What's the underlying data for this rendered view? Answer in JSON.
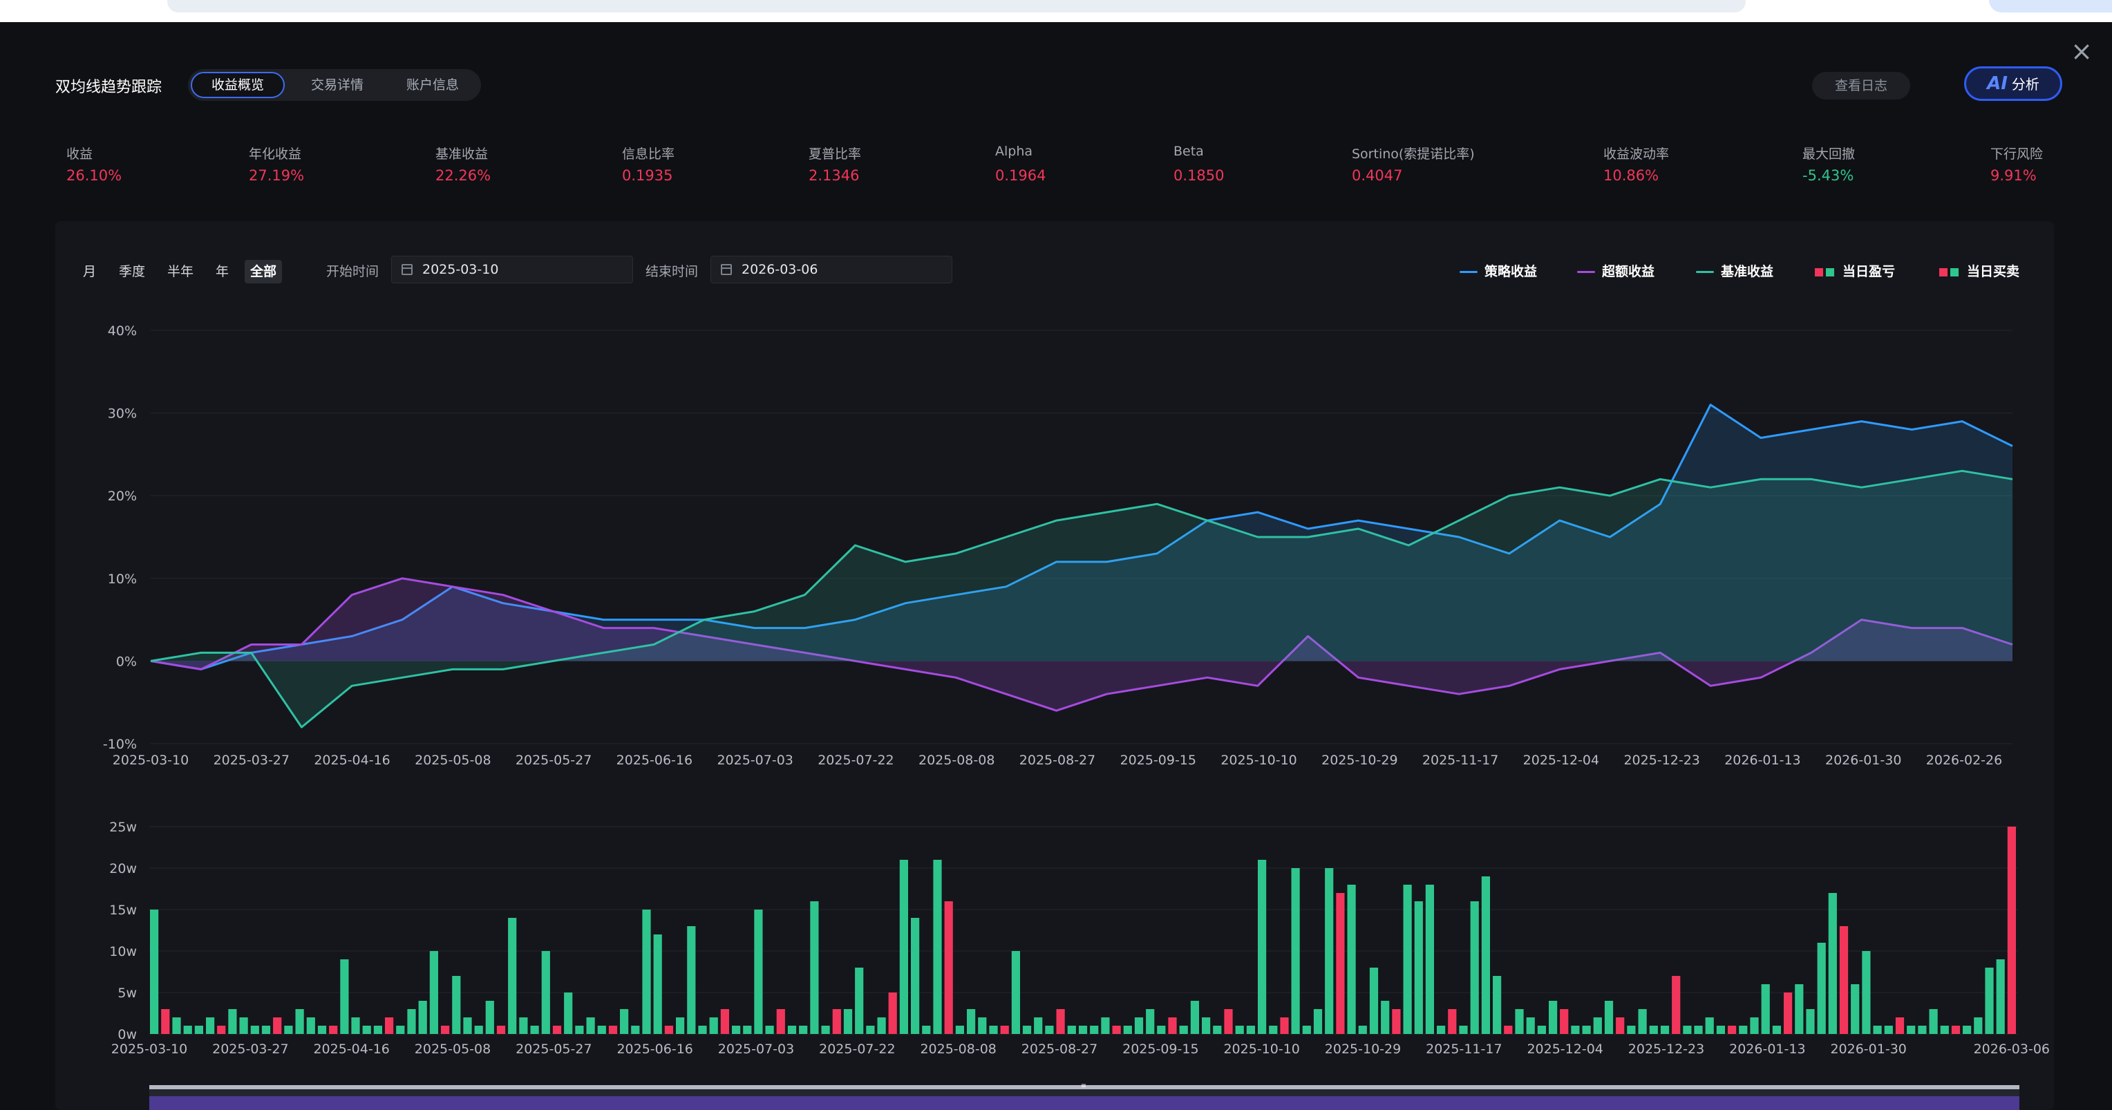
{
  "header": {
    "title": "双均线趋势跟踪",
    "tabs": [
      {
        "label": "收益概览",
        "active": true
      },
      {
        "label": "交易详情",
        "active": false
      },
      {
        "label": "账户信息",
        "active": false
      }
    ],
    "log_button": "查看日志",
    "ai_button": {
      "glyph": "AI",
      "label": "分析"
    },
    "close_icon": "close-icon"
  },
  "metrics": [
    {
      "label": "收益",
      "value": "26.10%",
      "tone": "neg"
    },
    {
      "label": "年化收益",
      "value": "27.19%",
      "tone": "neg"
    },
    {
      "label": "基准收益",
      "value": "22.26%",
      "tone": "neg"
    },
    {
      "label": "信息比率",
      "value": "0.1935",
      "tone": "neg"
    },
    {
      "label": "夏普比率",
      "value": "2.1346",
      "tone": "neg"
    },
    {
      "label": "Alpha",
      "value": "0.1964",
      "tone": "neg"
    },
    {
      "label": "Beta",
      "value": "0.1850",
      "tone": "neg"
    },
    {
      "label": "Sortino(索提诺比率)",
      "value": "0.4047",
      "tone": "neg"
    },
    {
      "label": "收益波动率",
      "value": "10.86%",
      "tone": "neg"
    },
    {
      "label": "最大回撤",
      "value": "-5.43%",
      "tone": "pos"
    },
    {
      "label": "下行风险",
      "value": "9.91%",
      "tone": "neg"
    }
  ],
  "filters": {
    "ranges": [
      {
        "label": "月",
        "active": false
      },
      {
        "label": "季度",
        "active": false
      },
      {
        "label": "半年",
        "active": false
      },
      {
        "label": "年",
        "active": false
      },
      {
        "label": "全部",
        "active": true
      }
    ],
    "start_label": "开始时间",
    "start_value": "2025-03-10",
    "end_label": "结束时间",
    "end_value": "2026-03-06"
  },
  "legend": [
    {
      "label": "策略收益",
      "kind": "line",
      "color": "#2f9bff"
    },
    {
      "label": "超额收益",
      "kind": "line",
      "color": "#a54ce0"
    },
    {
      "label": "基准收益",
      "kind": "line",
      "color": "#2fc1a4"
    },
    {
      "label": "当日盈亏",
      "kind": "squares",
      "colors": [
        "#f2365b",
        "#2fc68d"
      ]
    },
    {
      "label": "当日买卖",
      "kind": "squares",
      "colors": [
        "#f2365b",
        "#2fc68d"
      ]
    }
  ],
  "colors": {
    "strategy": "#2f9bff",
    "excess": "#a54ce0",
    "benchmark": "#2fc1a4",
    "up": "#f2365b",
    "down": "#2fc68d",
    "accent": "#2f5cf5"
  },
  "chart_data": [
    {
      "type": "line",
      "x_ticks": [
        "2025-03-10",
        "2025-03-27",
        "2025-04-16",
        "2025-05-08",
        "2025-05-27",
        "2025-06-16",
        "2025-07-03",
        "2025-07-22",
        "2025-08-08",
        "2025-08-27",
        "2025-09-15",
        "2025-10-10",
        "2025-10-29",
        "2025-11-17",
        "2025-12-04",
        "2025-12-23",
        "2026-01-13",
        "2026-01-30",
        "2026-02-26"
      ],
      "y_ticks": [
        "40%",
        "30%",
        "20%",
        "10%",
        "0%",
        "-10%"
      ],
      "ylim": [
        -10,
        40
      ],
      "area": true,
      "series": [
        {
          "name": "策略收益",
          "values": [
            0,
            -1,
            1,
            2,
            3,
            5,
            9,
            7,
            6,
            5,
            5,
            5,
            4,
            4,
            5,
            7,
            8,
            9,
            12,
            12,
            13,
            17,
            18,
            16,
            17,
            16,
            15,
            13,
            17,
            15,
            19,
            31,
            27,
            28,
            29,
            28,
            29,
            26
          ]
        },
        {
          "name": "超额收益",
          "values": [
            0,
            -1,
            2,
            2,
            8,
            10,
            9,
            8,
            6,
            4,
            4,
            3,
            2,
            1,
            0,
            -1,
            -2,
            -4,
            -6,
            -4,
            -3,
            -2,
            -3,
            3,
            -2,
            -3,
            -4,
            -3,
            -1,
            0,
            1,
            -3,
            -2,
            1,
            5,
            4,
            4,
            2
          ]
        },
        {
          "name": "基准收益",
          "values": [
            0,
            1,
            1,
            -8,
            -3,
            -2,
            -1,
            -1,
            0,
            1,
            2,
            5,
            6,
            8,
            14,
            12,
            13,
            15,
            17,
            18,
            19,
            17,
            15,
            15,
            16,
            14,
            17,
            20,
            21,
            20,
            22,
            21,
            22,
            22,
            21,
            22,
            23,
            22
          ]
        }
      ]
    },
    {
      "type": "bar",
      "x_ticks": [
        "2025-03-10",
        "2025-03-27",
        "2025-04-16",
        "2025-05-08",
        "2025-05-27",
        "2025-06-16",
        "2025-07-03",
        "2025-07-22",
        "2025-08-08",
        "2025-08-27",
        "2025-09-15",
        "2025-10-10",
        "2025-10-29",
        "2025-11-17",
        "2025-12-04",
        "2025-12-23",
        "2026-01-13",
        "2026-01-30",
        "2026-03-06"
      ],
      "y_ticks": [
        "25w",
        "20w",
        "15w",
        "10w",
        "5w",
        "0w"
      ],
      "ylim": [
        0,
        25
      ],
      "series": [
        {
          "name": "当日买卖",
          "values": [
            15,
            3,
            2,
            1,
            1,
            2,
            1,
            3,
            2,
            1,
            1,
            2,
            1,
            3,
            2,
            1,
            1,
            9,
            2,
            1,
            1,
            2,
            1,
            3,
            4,
            10,
            1,
            7,
            2,
            1,
            4,
            1,
            14,
            2,
            1,
            10,
            1,
            5,
            1,
            2,
            1,
            1,
            3,
            1,
            15,
            12,
            1,
            2,
            13,
            1,
            2,
            3,
            1,
            1,
            15,
            1,
            3,
            1,
            1,
            16,
            1,
            3,
            3,
            8,
            1,
            2,
            5,
            21,
            14,
            1,
            21,
            16,
            1,
            3,
            2,
            1,
            1,
            10,
            1,
            2,
            1,
            3,
            1,
            1,
            1,
            2,
            1,
            1,
            2,
            3,
            1,
            2,
            1,
            4,
            2,
            1,
            3,
            1,
            1,
            21,
            1,
            2,
            20,
            1,
            3,
            20,
            17,
            18,
            1,
            8,
            4,
            3,
            18,
            16,
            18,
            1,
            3,
            1,
            16,
            19,
            7,
            1,
            3,
            2,
            1,
            4,
            3,
            1,
            1,
            2,
            4,
            2,
            1,
            3,
            1,
            1,
            7,
            1,
            1,
            2,
            1,
            1,
            1,
            2,
            6,
            1,
            5,
            6,
            3,
            11,
            17,
            13,
            6,
            10,
            1,
            1,
            2,
            1,
            1,
            3,
            1,
            1,
            1,
            2,
            8,
            9,
            25
          ]
        }
      ]
    }
  ]
}
